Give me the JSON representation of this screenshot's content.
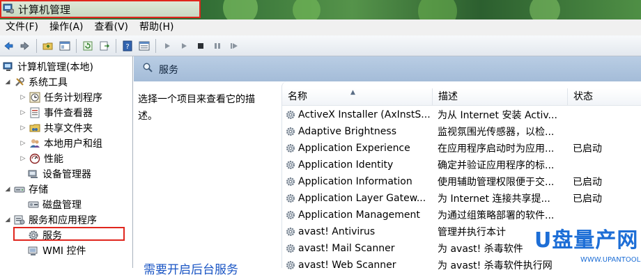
{
  "window": {
    "title": "计算机管理"
  },
  "menu": [
    "文件(F)",
    "操作(A)",
    "查看(V)",
    "帮助(H)"
  ],
  "tree": {
    "root": "计算机管理(本地)",
    "system_tools": "系统工具",
    "task_scheduler": "任务计划程序",
    "event_viewer": "事件查看器",
    "shared_folders": "共享文件夹",
    "local_users": "本地用户和组",
    "performance": "性能",
    "device_manager": "设备管理器",
    "storage": "存储",
    "disk_management": "磁盘管理",
    "services_apps": "服务和应用程序",
    "services": "服务",
    "wmi": "WMI 控件"
  },
  "pane": {
    "header": "服务",
    "description": "选择一个项目来查看它的描述。",
    "hint": "需要开启后台服务"
  },
  "columns": {
    "name": "名称",
    "description": "描述",
    "status": "状态"
  },
  "services": [
    {
      "name": "ActiveX Installer (AxInstS...",
      "description": "为从 Internet 安装 Activ...",
      "status": ""
    },
    {
      "name": "Adaptive Brightness",
      "description": "监视氛围光传感器，以检...",
      "status": ""
    },
    {
      "name": "Application Experience",
      "description": "在应用程序启动时为应用...",
      "status": "已启动"
    },
    {
      "name": "Application Identity",
      "description": "确定并验证应用程序的标...",
      "status": ""
    },
    {
      "name": "Application Information",
      "description": "使用辅助管理权限便于交...",
      "status": "已启动"
    },
    {
      "name": "Application Layer Gatew...",
      "description": "为 Internet 连接共享提...",
      "status": "已启动"
    },
    {
      "name": "Application Management",
      "description": "为通过组策略部署的软件...",
      "status": ""
    },
    {
      "name": "avast! Antivirus",
      "description": "管理并执行本计",
      "status": ""
    },
    {
      "name": "avast! Mail Scanner",
      "description": "为 avast! 杀毒软件",
      "status": ""
    },
    {
      "name": "avast! Web Scanner",
      "description": "为 avast! 杀毒软件执行网",
      "status": ""
    }
  ],
  "watermark": {
    "logo": "U盘量产网",
    "url": "WWW.UPANTOOL.COM"
  }
}
